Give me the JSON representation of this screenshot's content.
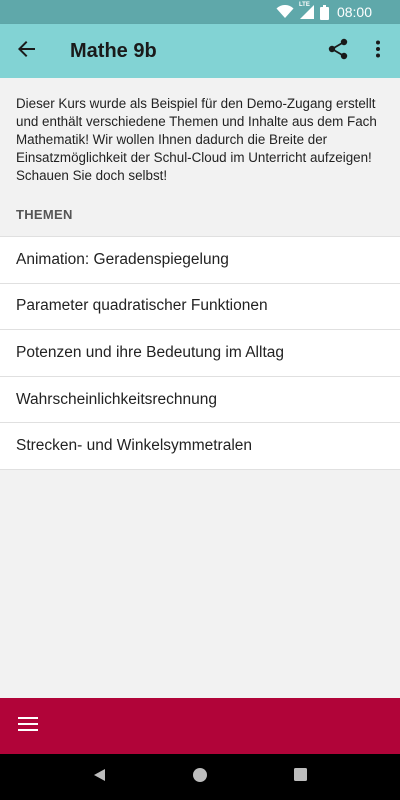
{
  "status_bar": {
    "time": "08:00",
    "network_label": "LTE",
    "icons": [
      "wifi-icon",
      "cellular-signal-icon",
      "battery-icon"
    ]
  },
  "app_bar": {
    "title": "Mathe 9b",
    "icons": [
      "back-arrow-icon",
      "share-icon",
      "more-vert-icon"
    ],
    "background_color": "#82d3d4"
  },
  "course": {
    "description": "Dieser Kurs wurde als Beispiel für den Demo-Zugang erstellt und enthält verschiedene Themen und Inhalte aus dem Fach Mathematik! Wir wollen Ihnen dadurch die Breite der Einsatzmöglichkeit der Schul-Cloud im Unterricht aufzeigen! Schauen Sie doch selbst!"
  },
  "topics": {
    "header": "THEMEN",
    "items": [
      {
        "label": "Animation: Geradenspiegelung"
      },
      {
        "label": "Parameter quadratischer Funktionen"
      },
      {
        "label": "Potenzen und ihre Bedeutung im Alltag"
      },
      {
        "label": "Wahrscheinlichkeitsrechnung"
      },
      {
        "label": "Strecken- und Winkelsymmetralen"
      }
    ]
  },
  "bottom_bar": {
    "icon": "menu-icon",
    "background_color": "#b10439"
  },
  "nav_bar": {
    "icons": [
      "nav-back-icon",
      "nav-home-icon",
      "nav-recents-icon"
    ]
  }
}
